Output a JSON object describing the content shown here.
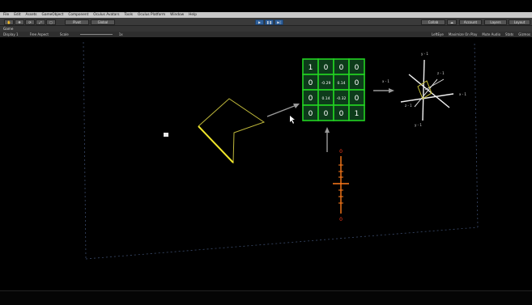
{
  "menu": [
    "File",
    "Edit",
    "Assets",
    "GameObject",
    "Component",
    "Oculus Avatars",
    "Tools",
    "Oculus Platform",
    "Window",
    "Help"
  ],
  "toolbar": {
    "pivot": "Pivot",
    "global": "Global",
    "collab": "Collab",
    "account": "Account",
    "layers": "Layers",
    "layout": "Layout"
  },
  "game_tab": "Game",
  "game_bar": {
    "display": "Display 1",
    "aspect": "Free Aspect",
    "scale_label": "Scale",
    "scale_value": "1x",
    "right_items": [
      "LeftEye",
      "Maximize On Play",
      "Mute Audio",
      "Stats",
      "Gizmos"
    ]
  },
  "scene": {
    "matrix": [
      [
        "1",
        "0",
        "0",
        "0"
      ],
      [
        "0",
        "-0.29",
        "0.14",
        "0"
      ],
      [
        "0",
        "0.14",
        "-0.32",
        "0"
      ],
      [
        "0",
        "0",
        "0",
        "1"
      ]
    ],
    "axis_labels": {
      "y_top": "y - 1",
      "y_bottom": "y - 1",
      "x_right": "x - 1",
      "x_left": "x - 1",
      "z_label": "z - 1",
      "z_neg": "z - 1"
    },
    "orange_labels": {
      "top": "0",
      "bottom": "0"
    },
    "colors": {
      "matrix_green": "#22d322",
      "polygon_yellow": "#e8dd2a",
      "orange_axis": "#ff7a1a",
      "arrow_gray": "#9a9a9a"
    }
  }
}
